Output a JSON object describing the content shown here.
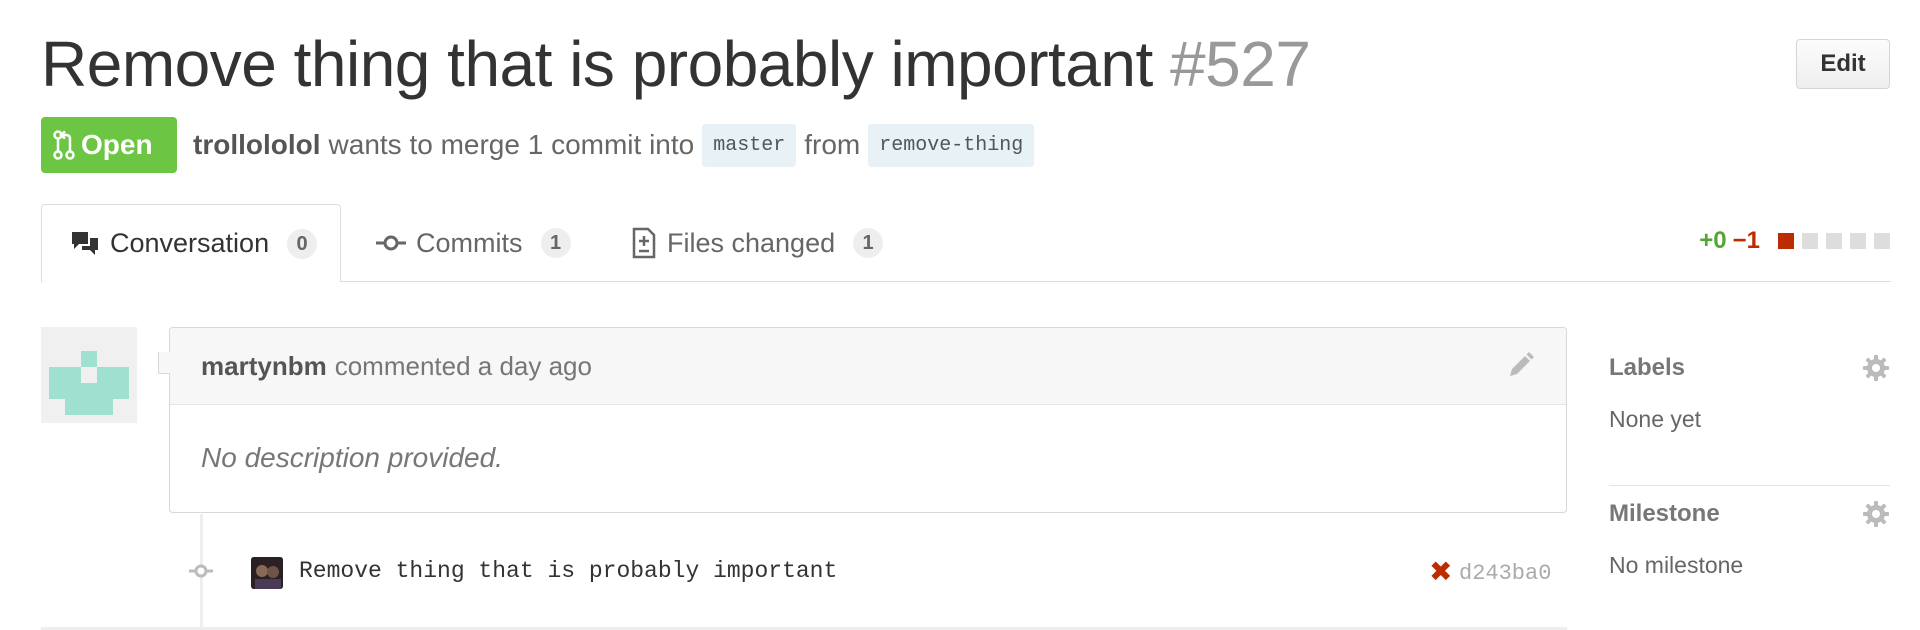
{
  "header": {
    "title": "Remove thing that is probably important",
    "number": "#527",
    "edit_label": "Edit"
  },
  "meta": {
    "state": "Open",
    "author": "trollololol",
    "text_merge": "wants to merge 1 commit into",
    "base_branch": "master",
    "text_from": "from",
    "head_branch": "remove-thing"
  },
  "tabs": [
    {
      "label": "Conversation",
      "count": "0"
    },
    {
      "label": "Commits",
      "count": "1"
    },
    {
      "label": "Files changed",
      "count": "1"
    }
  ],
  "diffstat": {
    "additions": "+0",
    "deletions": "−1"
  },
  "comment": {
    "author": "martynbm",
    "action": "commented a day ago",
    "body": "No description provided."
  },
  "commit": {
    "message": "Remove thing that is probably important",
    "status": "✖",
    "sha": "d243ba0"
  },
  "sidebar": {
    "labels": {
      "heading": "Labels",
      "value": "None yet"
    },
    "milestone": {
      "heading": "Milestone",
      "value": "No milestone"
    }
  },
  "colors": {
    "open_green": "#6cc644",
    "addition_green": "#55a532",
    "deletion_red": "#bd2c00",
    "avatar_teal": "#9fe0d0",
    "branch_bg": "#e8f1f6"
  },
  "icons": {
    "state": "git-pull-request-icon",
    "conversation_tab": "comment-discussion-icon",
    "commits_tab": "git-commit-icon",
    "files_tab": "diff-icon",
    "comment_edit": "pencil-icon",
    "sidebar_settings": "gear-icon",
    "commit_status": "x-icon"
  }
}
